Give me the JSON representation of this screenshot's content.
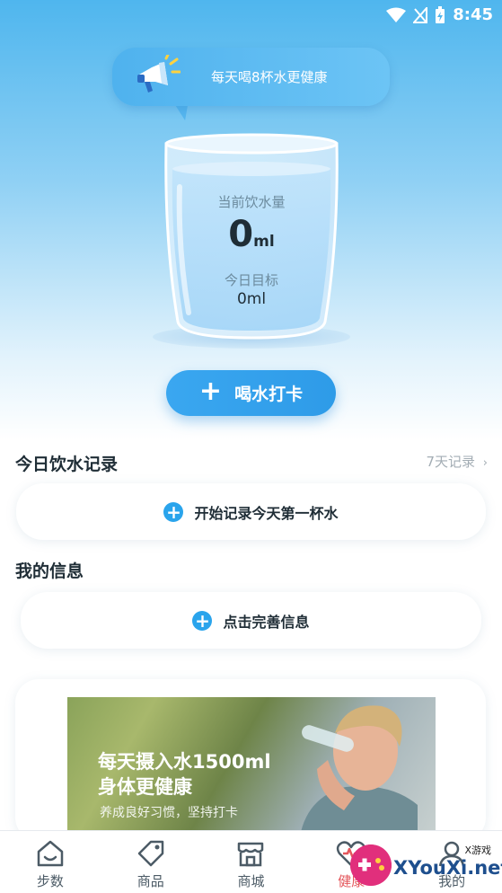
{
  "status_bar": {
    "time": "8:45"
  },
  "bubble": {
    "text": "每天喝8杯水更健康"
  },
  "glass": {
    "current_label": "当前饮水量",
    "current_value": "0",
    "current_unit": "ml",
    "goal_label": "今日目标",
    "goal_value": "0ml"
  },
  "drink_button": {
    "label": "喝水打卡"
  },
  "records": {
    "title": "今日饮水记录",
    "link": "7天记录",
    "start_label": "开始记录今天第一杯水"
  },
  "info": {
    "title": "我的信息",
    "complete_label": "点击完善信息"
  },
  "banner": {
    "headline1": "每天摄入水1500ml",
    "headline2": "身体更健康",
    "subline": "养成良好习惯，坚持打卡"
  },
  "nav": {
    "items": [
      {
        "label": "步数",
        "icon": "home-icon"
      },
      {
        "label": "商品",
        "icon": "tag-icon"
      },
      {
        "label": "商城",
        "icon": "store-icon"
      },
      {
        "label": "健康",
        "icon": "heart-icon"
      },
      {
        "label": "我的",
        "icon": "profile-icon"
      }
    ],
    "active_index": 3
  },
  "watermark": {
    "text": "XYouXi.net",
    "small": "X游戏"
  },
  "colors": {
    "accent": "#2aa4ec",
    "active_nav": "#e4565b"
  }
}
